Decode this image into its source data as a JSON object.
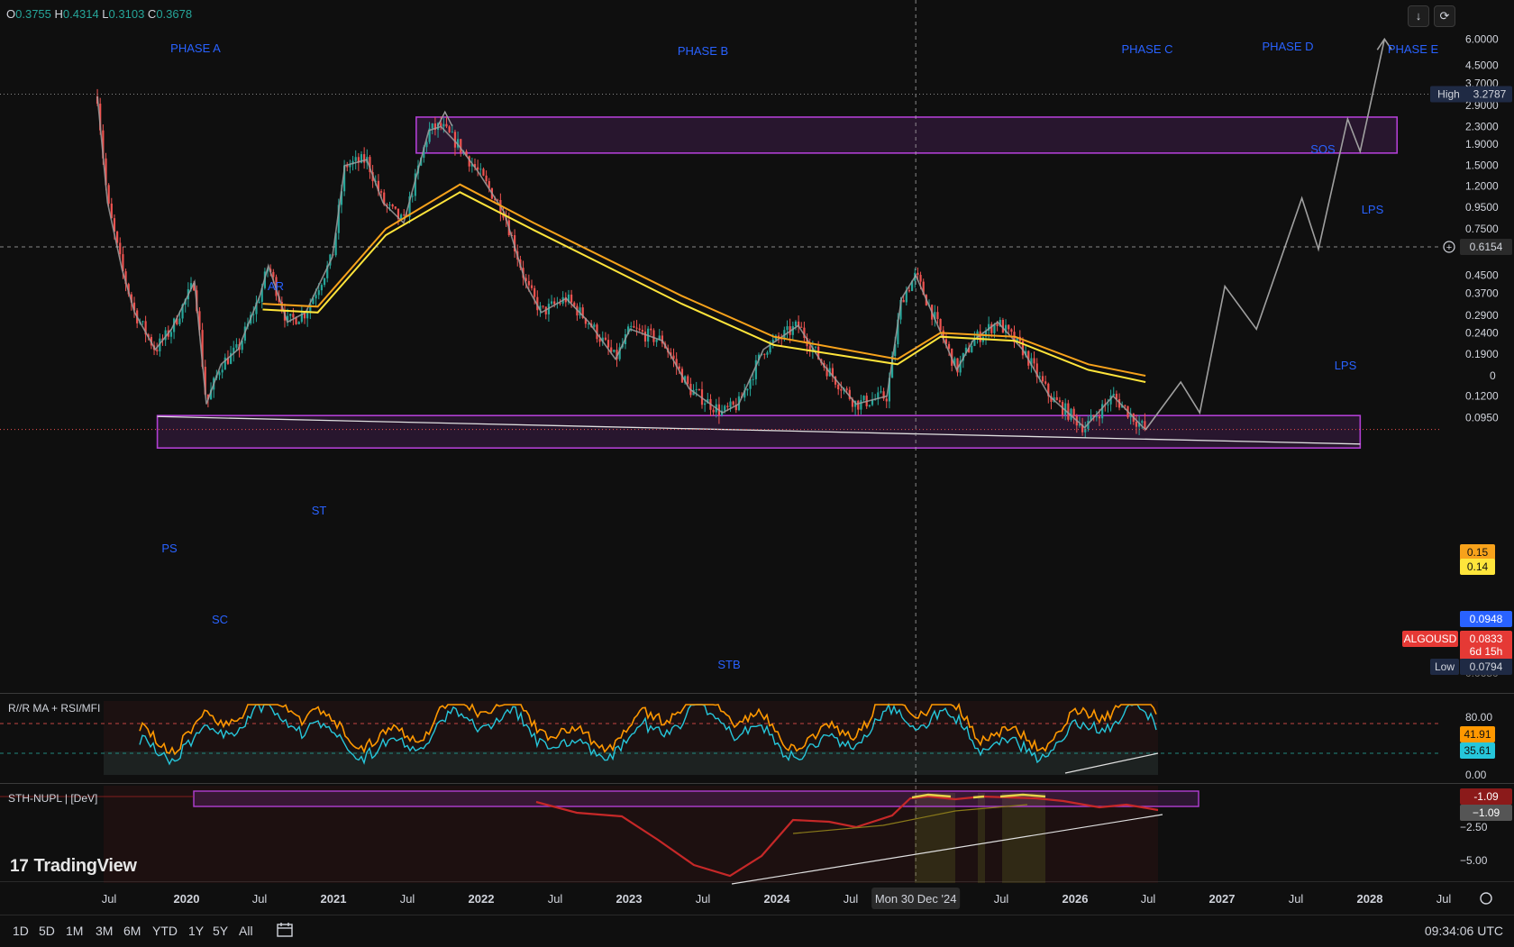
{
  "ohlc": {
    "o_label": "O",
    "o": "0.3755",
    "h_label": "H",
    "h": "0.4314",
    "l_label": "L",
    "l": "0.3103",
    "c_label": "C",
    "c": "0.3678"
  },
  "top_buttons": {
    "download_icon": "arrow-down-icon",
    "refresh_icon": "refresh-icon"
  },
  "phases": [
    "PHASE A",
    "PHASE B",
    "PHASE C",
    "PHASE D",
    "PHASE E"
  ],
  "wyckoff_labels": [
    "PS",
    "SC",
    "AR",
    "ST",
    "STB",
    "SOS",
    "LPS",
    "LPS"
  ],
  "price_axis": {
    "ticks": [
      "6.0000",
      "4.5000",
      "3.7000",
      "2.9000",
      "2.3000",
      "1.9000",
      "1.5000",
      "1.2000",
      "0.9500",
      "0.7500",
      "0.4500",
      "0.3700",
      "0.2900",
      "0.2400",
      "0.1900",
      "0.1200",
      "0.0950"
    ],
    "crosshair": "0.6154",
    "high_label": "High",
    "high": "3.2787",
    "low_label": "Low",
    "low": "0.0794",
    "ma1": "0.15",
    "ma2": "0.14",
    "blue_tag": "0.0948",
    "symbol": "ALGOUSD",
    "last": "0.0833",
    "countdown": "6d 15h",
    "partial_top": "0",
    "partial_bottom": "0.0650"
  },
  "rsi_pane": {
    "title": "R//R MA + RSI/MFI",
    "ticks": [
      "80.00",
      "0.00"
    ],
    "val1": "41.91",
    "val2": "35.61"
  },
  "nupl_pane": {
    "title": "STH-NUPL | [DeV]",
    "ticks": [
      "−2.50",
      "−5.00"
    ],
    "val1": "-1.09",
    "val2": "−1.09"
  },
  "time_axis": {
    "labels": [
      "Jul",
      "2020",
      "Jul",
      "2021",
      "Jul",
      "2022",
      "Jul",
      "2023",
      "Jul",
      "2024",
      "Jul",
      "Jul",
      "2026",
      "Jul",
      "2027",
      "Jul",
      "2028",
      "Jul"
    ],
    "crosshair_date": "Mon 30 Dec '24"
  },
  "branding": {
    "logo_text": "TradingView"
  },
  "bottom_bar": {
    "ranges": [
      "1D",
      "5D",
      "1M",
      "3M",
      "6M",
      "YTD",
      "1Y",
      "5Y",
      "All"
    ],
    "clock": "09:34:06 UTC"
  },
  "colors": {
    "bg": "#0f0f0f",
    "up": "#26a69a",
    "down": "#ef5350",
    "ma_orange": "#f7a21b",
    "ma_yellow": "#ffe53b",
    "box": "#b13fd3",
    "label_blue": "#2962ff",
    "rsi_orange": "#ff9800",
    "rsi_blue": "#26c6da",
    "nupl": "#c62828"
  },
  "chart_data": {
    "type": "candlestick",
    "symbol": "ALGOUSD",
    "scale": "log",
    "ylim": [
      0.065,
      6.0
    ],
    "x_range": [
      "2019-06",
      "2028-09"
    ],
    "price_path": [
      [
        "2019-06-20",
        3.2
      ],
      [
        "2019-07-15",
        1.0
      ],
      [
        "2019-08-20",
        0.48
      ],
      [
        "2019-09-20",
        0.3
      ],
      [
        "2019-11-10",
        0.2
      ],
      [
        "2019-12-20",
        0.25
      ],
      [
        "2020-02-15",
        0.42
      ],
      [
        "2020-03-15",
        0.11
      ],
      [
        "2020-04-20",
        0.17
      ],
      [
        "2020-06-01",
        0.2
      ],
      [
        "2020-07-25",
        0.36
      ],
      [
        "2020-08-15",
        0.5
      ],
      [
        "2020-10-01",
        0.27
      ],
      [
        "2020-11-15",
        0.3
      ],
      [
        "2021-01-20",
        0.55
      ],
      [
        "2021-02-20",
        1.5
      ],
      [
        "2021-04-15",
        1.6
      ],
      [
        "2021-05-25",
        1.0
      ],
      [
        "2021-07-15",
        0.8
      ],
      [
        "2021-09-15",
        2.2
      ],
      [
        "2021-10-15",
        2.3
      ],
      [
        "2021-11-25",
        1.9
      ],
      [
        "2022-01-15",
        1.4
      ],
      [
        "2022-03-20",
        0.9
      ],
      [
        "2022-05-15",
        0.4
      ],
      [
        "2022-06-20",
        0.3
      ],
      [
        "2022-08-20",
        0.35
      ],
      [
        "2022-10-15",
        0.27
      ],
      [
        "2022-12-20",
        0.18
      ],
      [
        "2023-01-25",
        0.25
      ],
      [
        "2023-04-15",
        0.22
      ],
      [
        "2023-06-20",
        0.13
      ],
      [
        "2023-09-10",
        0.1
      ],
      [
        "2023-10-20",
        0.11
      ],
      [
        "2023-12-20",
        0.2
      ],
      [
        "2024-03-15",
        0.26
      ],
      [
        "2024-05-15",
        0.17
      ],
      [
        "2024-08-05",
        0.11
      ],
      [
        "2024-10-20",
        0.12
      ],
      [
        "2024-11-25",
        0.35
      ],
      [
        "2024-12-30",
        0.45
      ],
      [
        "2025-02-15",
        0.28
      ],
      [
        "2025-04-10",
        0.16
      ],
      [
        "2025-05-20",
        0.22
      ],
      [
        "2025-07-20",
        0.27
      ],
      [
        "2025-09-20",
        0.2
      ],
      [
        "2025-11-25",
        0.12
      ],
      [
        "2026-02-20",
        0.085
      ],
      [
        "2026-05-01",
        0.12
      ],
      [
        "2026-07-20",
        0.083
      ]
    ],
    "moving_averages": [
      {
        "name": "MA orange",
        "last": 0.15,
        "points": [
          [
            "2020-08-01",
            0.33
          ],
          [
            "2020-12-15",
            0.32
          ],
          [
            "2021-06-01",
            0.75
          ],
          [
            "2021-12-01",
            1.22
          ],
          [
            "2022-06-01",
            0.8
          ],
          [
            "2023-06-01",
            0.36
          ],
          [
            "2024-01-15",
            0.23
          ],
          [
            "2024-11-15",
            0.18
          ],
          [
            "2025-03-01",
            0.24
          ],
          [
            "2025-09-01",
            0.23
          ],
          [
            "2026-03-01",
            0.17
          ],
          [
            "2026-07-20",
            0.15
          ]
        ]
      },
      {
        "name": "MA yellow",
        "last": 0.14,
        "points": [
          [
            "2020-08-01",
            0.31
          ],
          [
            "2020-12-15",
            0.3
          ],
          [
            "2021-06-01",
            0.7
          ],
          [
            "2021-12-01",
            1.12
          ],
          [
            "2022-06-01",
            0.74
          ],
          [
            "2023-06-01",
            0.33
          ],
          [
            "2024-01-15",
            0.21
          ],
          [
            "2024-11-15",
            0.17
          ],
          [
            "2025-03-01",
            0.23
          ],
          [
            "2025-09-01",
            0.22
          ],
          [
            "2026-03-01",
            0.16
          ],
          [
            "2026-07-20",
            0.14
          ]
        ]
      }
    ],
    "projection": [
      [
        "2026-07-20",
        0.083
      ],
      [
        "2026-10-15",
        0.14
      ],
      [
        "2026-12-01",
        0.1
      ],
      [
        "2027-02-01",
        0.4
      ],
      [
        "2027-04-20",
        0.25
      ],
      [
        "2027-08-10",
        1.05
      ],
      [
        "2027-09-20",
        0.6
      ],
      [
        "2027-12-01",
        2.5
      ],
      [
        "2028-01-01",
        1.75
      ],
      [
        "2028-03-01",
        6.0
      ]
    ],
    "boxes": [
      {
        "label": "accumulation range",
        "x": [
          "2019-11-15",
          "2028-01-01"
        ],
        "y": [
          0.068,
          0.097
        ]
      },
      {
        "label": "resistance",
        "x": [
          "2021-08-15",
          "2028-04-01"
        ],
        "y": [
          1.72,
          2.55
        ]
      }
    ],
    "high": 3.2787,
    "low": 0.0794,
    "last": 0.0833,
    "rsi": {
      "upper": 80,
      "lower": 0,
      "rsi": 41.91,
      "mfi": 35.61
    },
    "sth_nupl": {
      "value": -1.09
    }
  }
}
